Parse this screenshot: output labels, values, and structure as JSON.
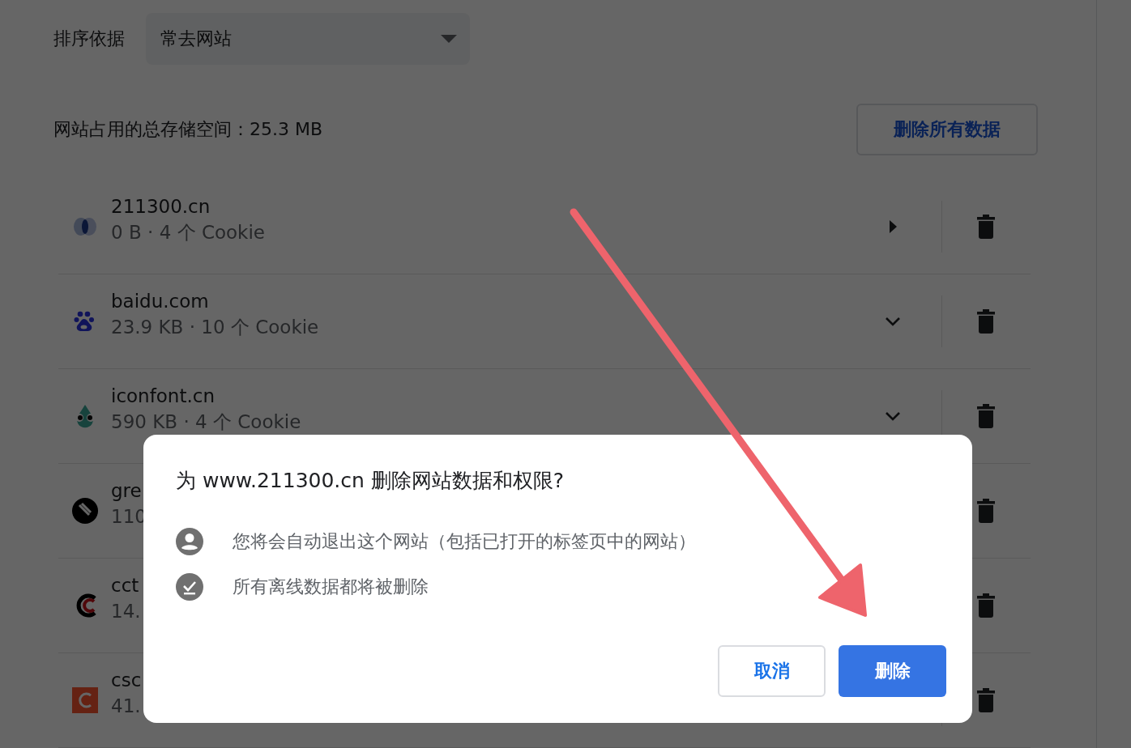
{
  "sort": {
    "label": "排序依据",
    "value": "常去网站"
  },
  "storage": {
    "text": "网站占用的总存储空间：25.3 MB",
    "button": "删除所有数据"
  },
  "sites": [
    {
      "name": "211300.cn",
      "detail": "0 B · 4 个 Cookie",
      "kind": "arrow"
    },
    {
      "name": "baidu.com",
      "detail": "23.9 KB · 10 个 Cookie",
      "kind": "chevron"
    },
    {
      "name": "iconfont.cn",
      "detail": "590 KB · 4 个 Cookie",
      "kind": "chevron"
    },
    {
      "name": "gre",
      "detail": "110"
    },
    {
      "name": "cct",
      "detail": "14."
    },
    {
      "name": "csc",
      "detail": "41."
    }
  ],
  "dialog": {
    "title": "为 www.211300.cn 删除网站数据和权限?",
    "items": [
      {
        "kind": "account",
        "text": "您将会自动退出这个网站（包括已打开的标签页中的网站）"
      },
      {
        "kind": "offline",
        "text": "所有离线数据都将被删除"
      }
    ],
    "buttons": [
      {
        "kind": "secondary",
        "label": "取消"
      },
      {
        "kind": "primary",
        "label": "删除"
      }
    ]
  }
}
